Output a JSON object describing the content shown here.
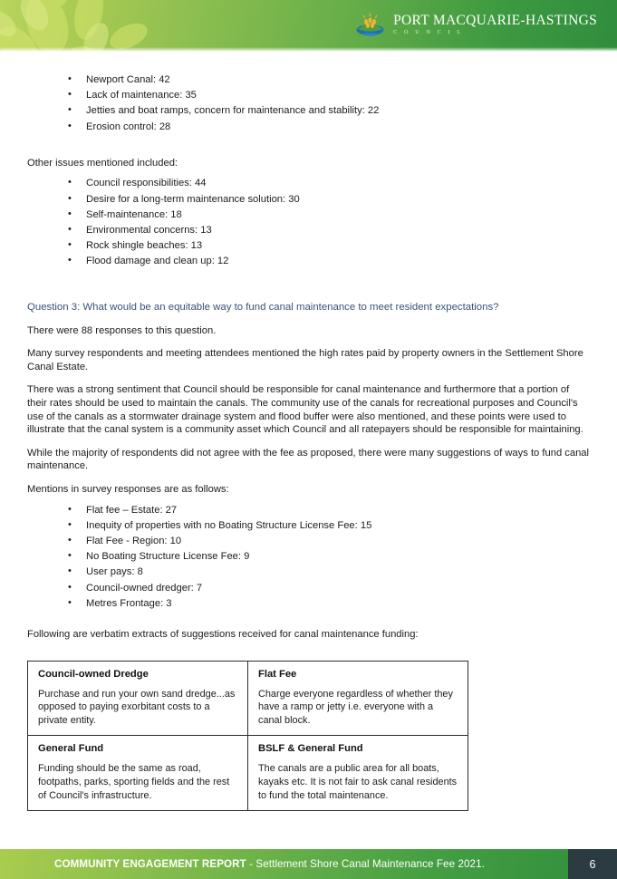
{
  "header": {
    "logo_title": "PORT MACQUARIE-HASTINGS",
    "logo_sub": "C O U N C I L",
    "logo_mark_name": "council-crest-icon"
  },
  "content": {
    "top_bullets": [
      "Newport Canal: 42",
      "Lack of maintenance: 35",
      "Jetties and boat ramps, concern for maintenance and stability: 22",
      "Erosion control: 28"
    ],
    "other_issues_intro": "Other issues mentioned included:",
    "other_issues_bullets": [
      "Council responsibilities: 44",
      "Desire for a long-term maintenance solution: 30",
      "Self-maintenance: 18",
      "Environmental concerns: 13",
      "Rock shingle beaches: 13",
      "Flood damage and clean up: 12"
    ],
    "question_heading": "Question 3: What would be an equitable way to fund canal maintenance to meet resident expectations?",
    "paragraphs": [
      "There were 88 responses to this question.",
      "Many survey respondents and meeting attendees mentioned the high rates paid by property owners in the Settlement Shore Canal Estate.",
      "There was a strong sentiment that Council should be responsible for canal maintenance and furthermore that a portion of their rates should be used to maintain the canals. The community use of the canals for recreational purposes and Council's use of the canals as a stormwater drainage system and flood buffer were also mentioned, and these points were used to illustrate that the canal system is a community asset which Council and all ratepayers should be responsible for maintaining.",
      "While the majority of respondents did not agree with the fee as proposed, there were many suggestions of ways to fund canal maintenance."
    ],
    "mentions_intro": "Mentions in survey responses are as follows:",
    "mentions_bullets": [
      "Flat fee – Estate: 27",
      "Inequity of properties with no Boating Structure License Fee: 15",
      "Flat Fee - Region: 10",
      "No Boating Structure License Fee: 9",
      "User pays: 8",
      "Council-owned dredger: 7",
      "Metres Frontage: 3"
    ],
    "verbatim_intro": "Following are verbatim extracts of suggestions received for canal maintenance funding:"
  },
  "table": {
    "rows": [
      [
        {
          "title": "Council-owned Dredge",
          "body": "Purchase and run your own sand dredge...as opposed to paying exorbitant costs to a private entity."
        },
        {
          "title": "Flat Fee",
          "body": "Charge everyone regardless of whether they have a ramp or jetty i.e. everyone with a canal block."
        }
      ],
      [
        {
          "title": "General Fund",
          "body": "Funding should be the same as road, footpaths, parks, sporting fields and the rest of Council's infrastructure."
        },
        {
          "title": "BSLF & General Fund",
          "body": "The canals are a public area for all boats, kayaks etc. It is not fair to ask canal residents to fund the total maintenance."
        }
      ]
    ]
  },
  "footer": {
    "title_bold": "COMMUNITY ENGAGEMENT REPORT",
    "title_rest": " - Settlement Shore Canal Maintenance Fee 2021.",
    "page_number": "6"
  },
  "colors": {
    "heading_blue": "#3b5277",
    "header_green_light": "#b8d45c",
    "header_green_dark": "#2f8d3d",
    "footer_page_bg": "#2c3a42"
  }
}
